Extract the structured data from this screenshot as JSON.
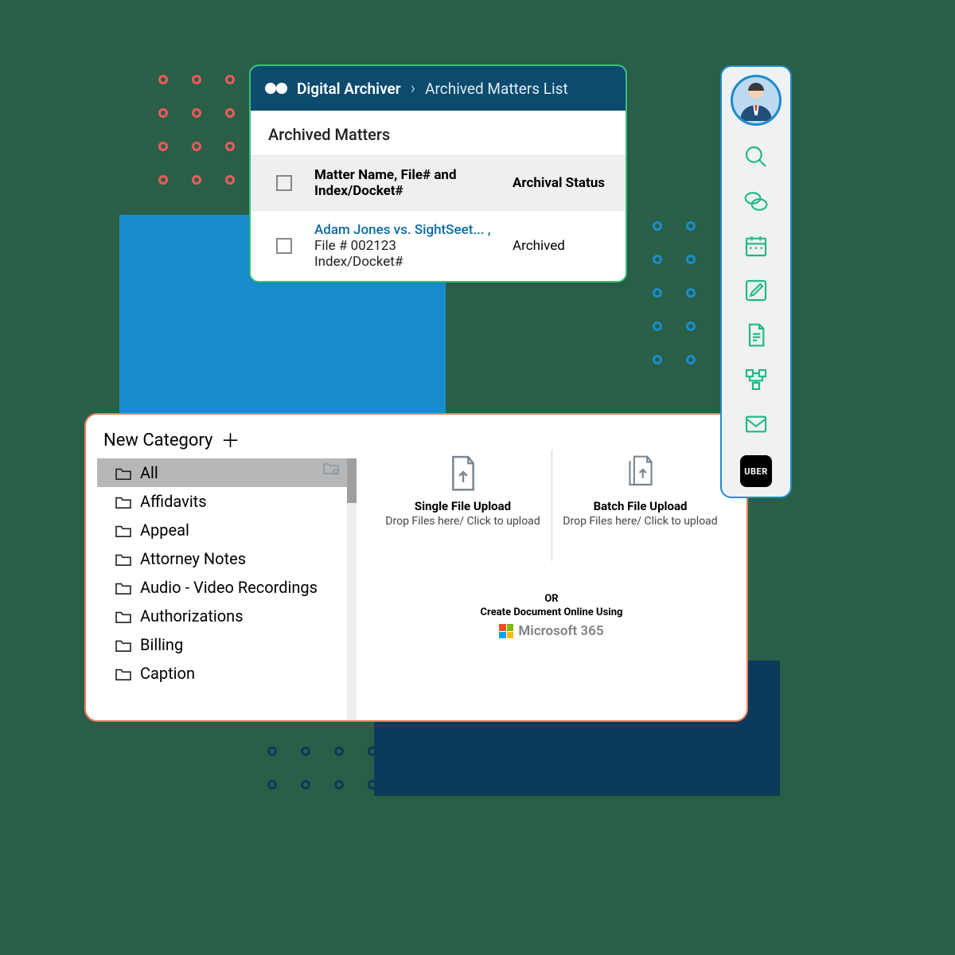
{
  "archiver": {
    "app_name": "Digital Archiver",
    "breadcrumb": "Archived Matters List",
    "section_title": "Archived Matters",
    "col1": "Matter Name, File# and Index/Docket#",
    "col2": "Archival Status",
    "row": {
      "link": "Adam Jones vs. SightSeet... ,",
      "file": "File # 002123",
      "docket": "Index/Docket#",
      "status": "Archived"
    }
  },
  "catpanel": {
    "new_category_label": "New Category",
    "categories": [
      "All",
      "Affidavits",
      "Appeal",
      "Attorney Notes",
      "Audio - Video Recordings",
      "Authorizations",
      "Billing",
      "Caption"
    ],
    "single_title": "Single File Upload",
    "single_sub": "Drop Files here/ Click to upload",
    "batch_title": "Batch File Upload",
    "batch_sub": "Drop Files here/ Click to upload",
    "or": "OR",
    "create_label": "Create Document Online Using",
    "ms365": "Microsoft 365"
  },
  "dock": {
    "uber": "UBER"
  }
}
